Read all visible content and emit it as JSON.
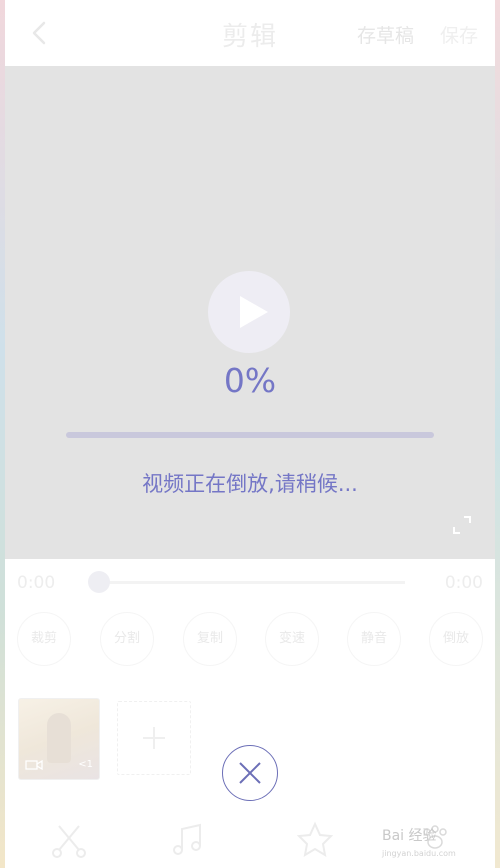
{
  "header": {
    "title": "剪辑",
    "draft_label": "存草稿",
    "save_label": "保存"
  },
  "preview": {
    "progress_text": "0%",
    "progress_fraction": 0,
    "status_text": "视频正在倒放,请稍候..."
  },
  "timeline": {
    "start_time": "0:00",
    "end_time": "0:00",
    "position_fraction": 0
  },
  "tools": [
    {
      "label": "裁剪"
    },
    {
      "label": "分割"
    },
    {
      "label": "复制"
    },
    {
      "label": "变速"
    },
    {
      "label": "静音"
    },
    {
      "label": "倒放"
    }
  ],
  "clip": {
    "duration_label": "<1"
  },
  "watermark": {
    "text": "Bai 经验",
    "subtext": "jingyan.baidu.com"
  },
  "colors": {
    "accent": "#7476c6",
    "preview_bg": "#e3e3e3",
    "progress_track": "#c9c8dc"
  },
  "icons": {
    "back": "chevron-left-icon",
    "play": "play-icon",
    "fullscreen": "fullscreen-icon",
    "add": "plus-icon",
    "close": "close-icon",
    "nav": [
      "scissors-icon",
      "music-icon",
      "star-icon",
      "paw-icon"
    ]
  }
}
